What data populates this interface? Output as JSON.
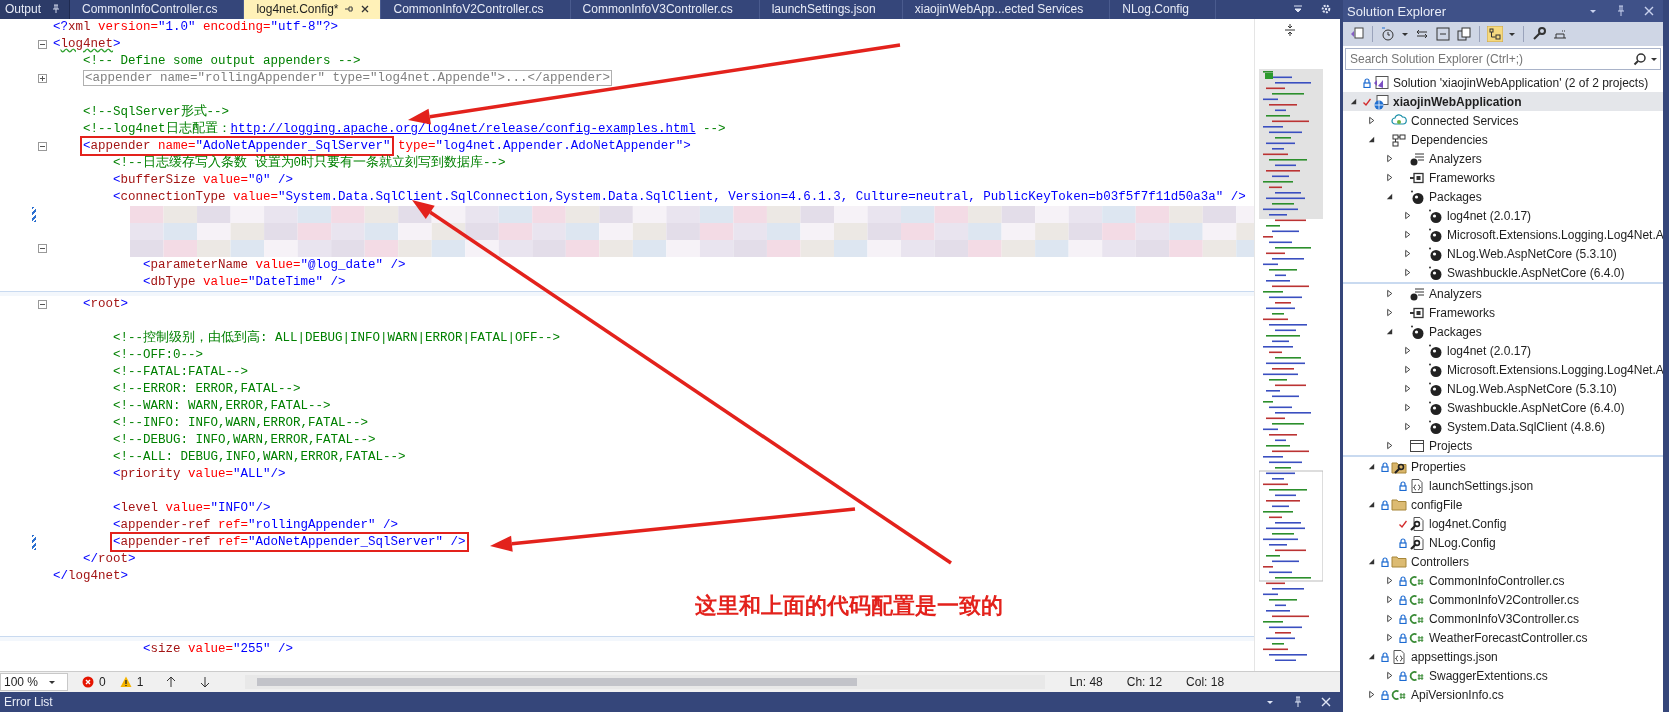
{
  "tool_window_tab": {
    "label": "Output"
  },
  "document_tabs": [
    {
      "label": "CommonInfoController.cs",
      "selected": false
    },
    {
      "label": "log4net.Config*",
      "selected": true
    },
    {
      "label": "CommonInfoV2Controller.cs",
      "selected": false
    },
    {
      "label": "CommonInfoV3Controller.cs",
      "selected": false
    },
    {
      "label": "launchSettings.json",
      "selected": false
    },
    {
      "label": "xiaojinWebApp...ected Services",
      "selected": false
    },
    {
      "label": "NLog.Config",
      "selected": false
    }
  ],
  "code_lines": [
    {
      "kind": "code",
      "tokens": [
        {
          "kind": "punct",
          "text": "<?"
        },
        {
          "kind": "tag",
          "text": "xml"
        },
        {
          "kind": "attr",
          "text": " version="
        },
        {
          "kind": "value",
          "text": "\"1.0\""
        },
        {
          "kind": "attr",
          "text": " encoding="
        },
        {
          "kind": "value",
          "text": "\"utf-8\""
        },
        {
          "kind": "punct",
          "text": "?>"
        }
      ]
    },
    {
      "kind": "code",
      "expanded": true,
      "tokens": [
        {
          "kind": "punct",
          "text": "<"
        },
        {
          "kind": "tag",
          "text": "log4net",
          "squiggle": true
        },
        {
          "kind": "punct",
          "text": ">"
        }
      ]
    },
    {
      "kind": "code",
      "tokens": [
        {
          "kind": "comment",
          "text": "    <!-- Define some output appenders -->"
        }
      ]
    },
    {
      "kind": "code",
      "expanded": false,
      "tokens": [
        {
          "kind": "collapsed",
          "text": "    <appender name=\"rollingAppender\" type=\"log4net.Appende\">...</appender>"
        }
      ]
    },
    {
      "kind": "blank"
    },
    {
      "kind": "code",
      "tokens": [
        {
          "kind": "comment",
          "text": "    <!--SqlServer形式-->"
        }
      ]
    },
    {
      "kind": "code",
      "tokens": [
        {
          "kind": "comment",
          "text": "    <!--log4net日志配置："
        },
        {
          "kind": "link",
          "text": "http://logging.apache.org/log4net/release/config-examples.html"
        },
        {
          "kind": "comment",
          "text": " -->"
        }
      ]
    },
    {
      "kind": "code",
      "expanded": true,
      "tokens": [
        {
          "kind": "punct",
          "text": "    <",
          "boxed": true
        },
        {
          "kind": "tag",
          "text": "appender",
          "boxed": true
        },
        {
          "kind": "attr",
          "text": " name=",
          "boxed": true
        },
        {
          "kind": "value",
          "text": "\"AdoNetAppender_SqlServer\"",
          "boxed": true
        },
        {
          "kind": "attr",
          "text": " type="
        },
        {
          "kind": "value",
          "text": "\"log4net.Appender.AdoNetAppender\""
        },
        {
          "kind": "punct",
          "text": ">"
        }
      ]
    },
    {
      "kind": "code",
      "tokens": [
        {
          "kind": "comment",
          "text": "        <!--日志缓存写入条数 设置为0时只要有一条就立刻写到数据库-->"
        }
      ]
    },
    {
      "kind": "code",
      "tokens": [
        {
          "kind": "punct",
          "text": "        <"
        },
        {
          "kind": "tag",
          "text": "bufferSize"
        },
        {
          "kind": "attr",
          "text": " value="
        },
        {
          "kind": "value",
          "text": "\"0\""
        },
        {
          "kind": "punct",
          "text": " />"
        }
      ]
    },
    {
      "kind": "code",
      "tokens": [
        {
          "kind": "punct",
          "text": "        <"
        },
        {
          "kind": "tag",
          "text": "connectionType"
        },
        {
          "kind": "attr",
          "text": " value="
        },
        {
          "kind": "value",
          "text": "\"System.Data.SqlClient.SqlConnection,System.Data.SqlClient, Version=4.6.1.3, Culture=neutral, PublicKeyToken=b03f5f7f11d50a3a\""
        },
        {
          "kind": "punct",
          "text": " />"
        }
      ]
    },
    {
      "kind": "redacted",
      "changed": true
    },
    {
      "kind": "redacted"
    },
    {
      "kind": "redacted",
      "expanded": true
    },
    {
      "kind": "code",
      "tokens": [
        {
          "kind": "punct",
          "text": "            <"
        },
        {
          "kind": "tag",
          "text": "parameterName"
        },
        {
          "kind": "attr",
          "text": " value="
        },
        {
          "kind": "value",
          "text": "\"@log_date\""
        },
        {
          "kind": "punct",
          "text": " />"
        }
      ]
    },
    {
      "kind": "code",
      "tokens": [
        {
          "kind": "punct",
          "text": "            <"
        },
        {
          "kind": "tag",
          "text": "dbType"
        },
        {
          "kind": "attr",
          "text": " value="
        },
        {
          "kind": "value",
          "text": "\"DateTime\""
        },
        {
          "kind": "punct",
          "text": " />"
        }
      ]
    },
    {
      "kind": "seam"
    },
    {
      "kind": "code",
      "expanded": true,
      "tokens": [
        {
          "kind": "punct",
          "text": "    <"
        },
        {
          "kind": "tag",
          "text": "root"
        },
        {
          "kind": "punct",
          "text": ">"
        }
      ]
    },
    {
      "kind": "blank"
    },
    {
      "kind": "code",
      "tokens": [
        {
          "kind": "comment",
          "text": "        <!--控制级别，由低到高: ALL|DEBUG|INFO|WARN|ERROR|FATAL|OFF-->"
        }
      ]
    },
    {
      "kind": "code",
      "tokens": [
        {
          "kind": "comment",
          "text": "        <!--OFF:0-->"
        }
      ]
    },
    {
      "kind": "code",
      "tokens": [
        {
          "kind": "comment",
          "text": "        <!--FATAL:FATAL-->"
        }
      ]
    },
    {
      "kind": "code",
      "tokens": [
        {
          "kind": "comment",
          "text": "        <!--ERROR: ERROR,FATAL-->"
        }
      ]
    },
    {
      "kind": "code",
      "tokens": [
        {
          "kind": "comment",
          "text": "        <!--WARN: WARN,ERROR,FATAL-->"
        }
      ]
    },
    {
      "kind": "code",
      "tokens": [
        {
          "kind": "comment",
          "text": "        <!--INFO: INFO,WARN,ERROR,FATAL-->"
        }
      ]
    },
    {
      "kind": "code",
      "tokens": [
        {
          "kind": "comment",
          "text": "        <!--DEBUG: INFO,WARN,ERROR,FATAL-->"
        }
      ]
    },
    {
      "kind": "code",
      "tokens": [
        {
          "kind": "comment",
          "text": "        <!--ALL: DEBUG,INFO,WARN,ERROR,FATAL-->"
        }
      ]
    },
    {
      "kind": "code",
      "tokens": [
        {
          "kind": "punct",
          "text": "        <"
        },
        {
          "kind": "tag",
          "text": "priority"
        },
        {
          "kind": "attr",
          "text": " value="
        },
        {
          "kind": "value",
          "text": "\"ALL\""
        },
        {
          "kind": "punct",
          "text": "/>"
        }
      ]
    },
    {
      "kind": "blank"
    },
    {
      "kind": "code",
      "tokens": [
        {
          "kind": "punct",
          "text": "        <"
        },
        {
          "kind": "tag",
          "text": "level"
        },
        {
          "kind": "attr",
          "text": " value="
        },
        {
          "kind": "value",
          "text": "\"INFO\""
        },
        {
          "kind": "punct",
          "text": "/>"
        }
      ]
    },
    {
      "kind": "code",
      "tokens": [
        {
          "kind": "punct",
          "text": "        <"
        },
        {
          "kind": "tag",
          "text": "appender-ref"
        },
        {
          "kind": "attr",
          "text": " ref="
        },
        {
          "kind": "value",
          "text": "\"rollingAppender\""
        },
        {
          "kind": "punct",
          "text": " />"
        }
      ]
    },
    {
      "kind": "code",
      "changed": true,
      "tokens": [
        {
          "kind": "punct",
          "text": "        <",
          "boxed": true
        },
        {
          "kind": "tag",
          "text": "appender-ref",
          "boxed": true
        },
        {
          "kind": "attr",
          "text": " ref=",
          "boxed": true
        },
        {
          "kind": "value",
          "text": "\"AdoNetAppender_SqlServer\"",
          "boxed": true
        },
        {
          "kind": "punct",
          "text": " />",
          "boxed": true
        }
      ]
    },
    {
      "kind": "code",
      "tokens": [
        {
          "kind": "punct",
          "text": "    </"
        },
        {
          "kind": "tag",
          "text": "root"
        },
        {
          "kind": "punct",
          "text": ">"
        }
      ]
    },
    {
      "kind": "code",
      "tokens": [
        {
          "kind": "punct",
          "text": "</"
        },
        {
          "kind": "tag",
          "text": "log4net"
        },
        {
          "kind": "punct",
          "text": ">"
        }
      ]
    },
    {
      "kind": "blank"
    },
    {
      "kind": "blank"
    },
    {
      "kind": "blank"
    },
    {
      "kind": "seam"
    },
    {
      "kind": "code",
      "tokens": [
        {
          "kind": "punct",
          "text": "            <"
        },
        {
          "kind": "tag",
          "text": "size"
        },
        {
          "kind": "attr",
          "text": " value="
        },
        {
          "kind": "value",
          "text": "\"255\""
        },
        {
          "kind": "punct",
          "text": " />"
        }
      ]
    }
  ],
  "annotation_note": "这里和上面的代码配置是一致的",
  "status_bar": {
    "zoom": "100 %",
    "errors": "0",
    "warnings": "1",
    "line": "Ln: 48",
    "char": "Ch: 12",
    "column": "Col: 18"
  },
  "bottom_panel": {
    "title": "Error List"
  },
  "solution_explorer": {
    "title": "Solution Explorer",
    "search": {
      "placeholder": "Search Solution Explorer (Ctrl+;)"
    },
    "tree": [
      {
        "label": "Solution 'xiaojinWebApplication' (2 of 2 projects)",
        "kind": "solution",
        "locked": true,
        "selected": false
      },
      {
        "label": "xiaojinWebApplication",
        "kind": "web",
        "expanded": true,
        "modified": true,
        "startup_project": true,
        "selected": true,
        "children": [
          {
            "label": "Connected Services",
            "kind": "cloud",
            "expanded": false,
            "selected": false
          },
          {
            "label": "Dependencies",
            "kind": "dependencies",
            "expanded": true,
            "selected": false,
            "children": [
              {
                "label": "Analyzers",
                "kind": "analyzers",
                "expanded": false,
                "selected": false
              },
              {
                "label": "Frameworks",
                "kind": "frameworks",
                "expanded": false,
                "selected": false
              },
              {
                "label": "Packages",
                "kind": "package",
                "expanded": true,
                "selected": false,
                "children": [
                  {
                    "label": "log4net (2.0.17)",
                    "kind": "package",
                    "expanded": false,
                    "selected": false
                  },
                  {
                    "label": "Microsoft.Extensions.Logging.Log4Net.A",
                    "kind": "package",
                    "expanded": false,
                    "selected": false
                  },
                  {
                    "label": "NLog.Web.AspNetCore (5.3.10)",
                    "kind": "package",
                    "expanded": false,
                    "selected": false
                  },
                  {
                    "label": "Swashbuckle.AspNetCore (6.4.0)",
                    "kind": "package",
                    "expanded": false,
                    "selected": false
                  }
                ]
              }
            ]
          }
        ]
      }
    ],
    "dependencies_continued": [
      {
        "label": "Analyzers",
        "kind": "analyzers",
        "expanded": false,
        "selected": false
      },
      {
        "label": "Frameworks",
        "kind": "frameworks",
        "expanded": false,
        "selected": false
      },
      {
        "label": "Packages",
        "kind": "package",
        "expanded": true,
        "selected": false,
        "children": [
          {
            "label": "log4net (2.0.17)",
            "kind": "package",
            "expanded": false,
            "selected": false
          },
          {
            "label": "Microsoft.Extensions.Logging.Log4Net.A",
            "kind": "package",
            "expanded": false,
            "selected": false
          },
          {
            "label": "NLog.Web.AspNetCore (5.3.10)",
            "kind": "package",
            "expanded": false,
            "selected": false
          },
          {
            "label": "Swashbuckle.AspNetCore (6.4.0)",
            "kind": "package",
            "expanded": false,
            "selected": false
          },
          {
            "label": "System.Data.SqlClient (4.8.6)",
            "kind": "package",
            "expanded": false,
            "selected": false
          }
        ]
      },
      {
        "label": "Projects",
        "kind": "projects",
        "expanded": false,
        "selected": false
      }
    ],
    "project_items_continued": [
      {
        "label": "Properties",
        "kind": "properties",
        "expanded": true,
        "locked": true,
        "selected": false,
        "children": [
          {
            "label": "launchSettings.json",
            "kind": "json",
            "locked": true,
            "selected": false
          }
        ]
      },
      {
        "label": "configFile",
        "kind": "folder",
        "expanded": true,
        "locked": true,
        "selected": false,
        "children": [
          {
            "label": "log4net.Config",
            "kind": "config",
            "modified": true,
            "selected": false
          },
          {
            "label": "NLog.Config",
            "kind": "config",
            "locked": true,
            "selected": false
          }
        ]
      },
      {
        "label": "Controllers",
        "kind": "folder",
        "expanded": true,
        "locked": true,
        "selected": false,
        "children": [
          {
            "label": "CommonInfoController.cs",
            "kind": "csharp",
            "expanded": false,
            "locked": true,
            "selected": false
          },
          {
            "label": "CommonInfoV2Controller.cs",
            "kind": "csharp",
            "expanded": false,
            "locked": true,
            "selected": false
          },
          {
            "label": "CommonInfoV3Controller.cs",
            "kind": "csharp",
            "expanded": false,
            "locked": true,
            "selected": false
          },
          {
            "label": "WeatherForecastController.cs",
            "kind": "csharp",
            "expanded": false,
            "locked": true,
            "selected": false
          }
        ]
      },
      {
        "label": "appsettings.json",
        "kind": "json",
        "expanded": true,
        "locked": true,
        "selected": false,
        "children": [
          {
            "label": "SwaggerExtentions.cs",
            "kind": "csharp",
            "expanded": false,
            "locked": true,
            "selected": false
          }
        ]
      },
      {
        "label": "ApiVersionInfo.cs",
        "kind": "csharp",
        "expanded": false,
        "locked": true,
        "selected": false
      }
    ]
  }
}
